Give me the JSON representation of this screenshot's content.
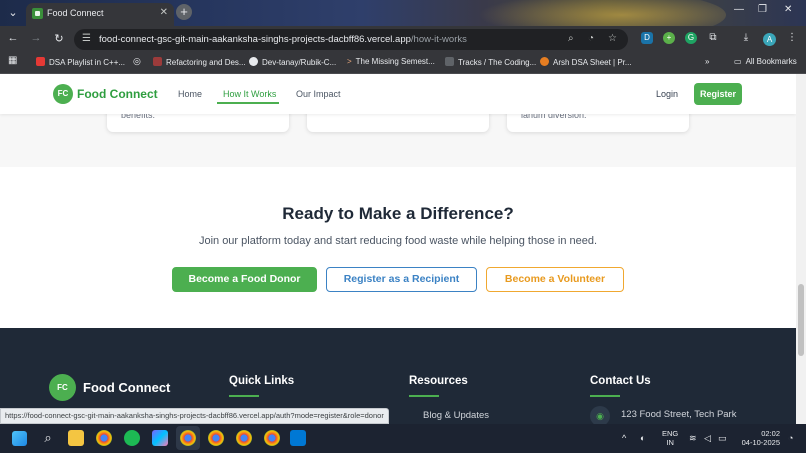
{
  "browser": {
    "tab_title": "Food Connect",
    "url_host": "food-connect-gsc-git-main-aakanksha-singhs-projects-dacbff86.vercel.app",
    "url_path": "/how-it-works",
    "profile_initial": "A",
    "bookmarks": [
      "DSA Playlist in C++...",
      "Refactoring and Des...",
      "Dev-tanay/Rubik-C...",
      "The Missing Semest...",
      "Tracks / The Coding...",
      "Arsh DSA Sheet | Pr..."
    ],
    "all_bookmarks": "All Bookmarks",
    "status_url": "https://food-connect-gsc-git-main-aakanksha-singhs-projects-dacbff86.vercel.app/auth?mode=register&role=donor"
  },
  "header": {
    "logo_initials": "FC",
    "brand": "Food Connect",
    "nav": [
      "Home",
      "How It Works",
      "Our Impact"
    ],
    "login": "Login",
    "register": "Register"
  },
  "cards": {
    "left_text": "benefits.",
    "right_text": "lanum diversion."
  },
  "cta": {
    "title": "Ready to Make a Difference?",
    "subtitle": "Join our platform today and start reducing food waste while helping those in need.",
    "donor_button": "Become a Food Donor",
    "recipient_button": "Register as a Recipient",
    "volunteer_button": "Become a Volunteer"
  },
  "footer": {
    "logo_initials": "FC",
    "brand": "Food Connect",
    "quick_links": "Quick Links",
    "resources": "Resources",
    "contact_us": "Contact Us",
    "blog_link": "Blog & Updates",
    "address": "123 Food Street, Tech Park"
  },
  "taskbar": {
    "lang_top": "ENG",
    "lang_bottom": "IN",
    "time": "02:02",
    "date": "04-10-2025"
  },
  "colors": {
    "brand_green": "#4caf50",
    "recipient_blue": "#3b82c4",
    "volunteer_orange": "#f0a830",
    "footer_bg": "#1f2937"
  }
}
